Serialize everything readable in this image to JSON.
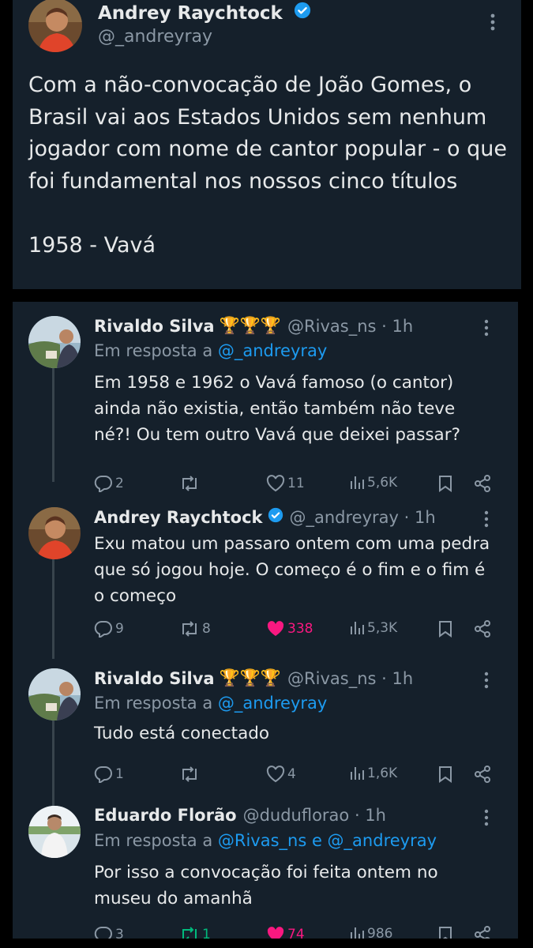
{
  "main_tweet": {
    "name": "Andrey Raychtock",
    "handle": "@_andreyray",
    "text": "Com a não-convocação de João Gomes, o Brasil vai aos Estados Unidos sem nenhum jogador com nome de cantor popular - o que foi fundamental nos nossos cinco títulos\n\n1958 - Vavá"
  },
  "replies": [
    {
      "name": "Rivaldo Silva",
      "trophies": "🏆🏆🏆",
      "meta": "@Rivas_ns · 1h",
      "reply_to_prefix": "Em resposta a ",
      "reply_to": "@_andreyray",
      "text": "Em 1958 e 1962 o Vavá famoso (o cantor) ainda não existia, então também não teve né?! Ou tem outro Vavá que deixei passar?",
      "replies": "2",
      "reposts": "",
      "likes": "11",
      "views": "5,6K"
    },
    {
      "name": "Andrey Raychtock",
      "meta": "@_andreyray · 1h",
      "text": "Exu matou um passaro ontem com uma pedra que só jogou hoje. O começo é o fim e o fim é o começo",
      "replies": "9",
      "reposts": "8",
      "likes": "338",
      "views": "5,3K"
    },
    {
      "name": "Rivaldo Silva",
      "trophies": "🏆🏆🏆",
      "meta": "@Rivas_ns · 1h",
      "reply_to_prefix": "Em resposta a ",
      "reply_to": "@_andreyray",
      "text": "Tudo está conectado",
      "replies": "1",
      "reposts": "",
      "likes": "4",
      "views": "1,6K"
    },
    {
      "name": "Eduardo Florão",
      "meta": "@duduflorao · 1h",
      "reply_to_prefix": "Em resposta a ",
      "reply_to": "@Rivas_ns e @_andreyray",
      "text": "Por isso a convocação foi feita ontem no museu do amanhã",
      "replies": "3",
      "reposts": "1",
      "likes": "74",
      "views": "986"
    }
  ],
  "colors": {
    "background": "#15202b",
    "text": "#e7e9ea",
    "secondary": "#8b98a5",
    "accent": "#1d9bf0",
    "like": "#f91880",
    "repost": "#00ba7c"
  }
}
